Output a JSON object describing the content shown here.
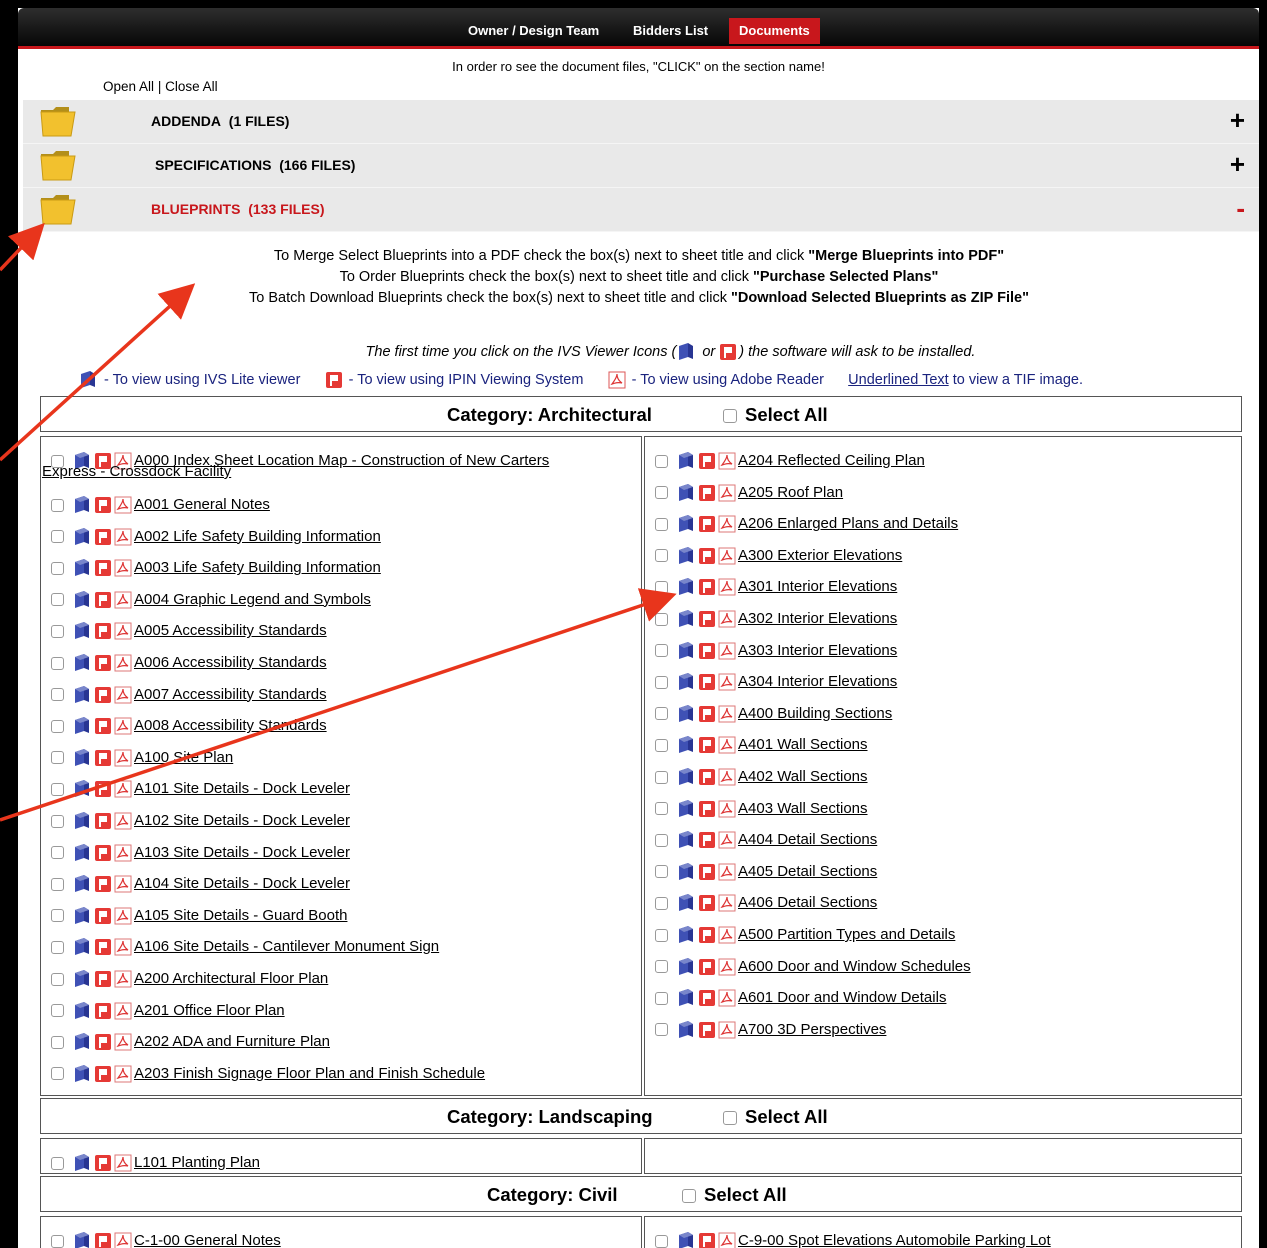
{
  "nav": {
    "tabs": [
      {
        "label": "Owner / Design Team"
      },
      {
        "label": "Bidders List"
      },
      {
        "label": "Documents"
      }
    ]
  },
  "notice": "In order ro see the document files, \"CLICK\" on the section name!",
  "open_all": "Open All",
  "separator": "|",
  "close_all": "Close All",
  "sections": [
    {
      "label": "ADDENDA",
      "count": "(1 FILES)",
      "toggle": "+"
    },
    {
      "label": "SPECIFICATIONS",
      "count": "(166 FILES)",
      "toggle": "+"
    },
    {
      "label": "BLUEPRINTS",
      "count": "(133 FILES)",
      "toggle": "-"
    }
  ],
  "instructions": [
    {
      "text": "To Merge Select Blueprints into a PDF check the box(s) next to sheet title and click ",
      "bold": "\"Merge Blueprints into PDF\""
    },
    {
      "text": "To Order Blueprints check the box(s) next to sheet title and click ",
      "bold": "\"Purchase Selected Plans\""
    },
    {
      "text": "To Batch Download Blueprints check the box(s) next to sheet title and click ",
      "bold": "\"Download Selected Blueprints as ZIP File\""
    }
  ],
  "first_time": {
    "a": "The first time you click on the IVS Viewer Icons (",
    "or": " or ",
    "b": ") the software will ask to be installed."
  },
  "legend": {
    "ivs": "- To view using IVS Lite viewer",
    "ipin": "- To view using IPIN Viewing System",
    "adobe": "- To view using Adobe Reader",
    "tif_link": "Underlined Text",
    "tif_rest": " to view a TIF image."
  },
  "select_all": "Select All",
  "categories": [
    {
      "title": "Category: Architectural",
      "left": [
        "A000 Index Sheet Location Map - Construction of New Carters",
        "Express - Crossdock Facility",
        "A001 General Notes",
        "A002 Life Safety Building Information",
        "A003 Life Safety Building Information",
        "A004 Graphic Legend and Symbols",
        "A005 Accessibility Standards",
        "A006 Accessibility Standards",
        "A007 Accessibility Standards",
        "A008 Accessibility Standards",
        "A100 Site Plan",
        "A101 Site Details - Dock Leveler",
        "A102 Site Details - Dock Leveler",
        "A103 Site Details - Dock Leveler",
        "A104 Site Details - Dock Leveler",
        "A105 Site Details - Guard Booth",
        "A106 Site Details - Cantilever Monument Sign",
        "A200 Architectural Floor Plan",
        "A201 Office Floor Plan",
        "A202 ADA and Furniture Plan",
        "A203 Finish Signage Floor Plan and Finish Schedule"
      ],
      "right": [
        "A204 Reflected Ceiling Plan",
        "A205 Roof Plan",
        "A206 Enlarged Plans and Details",
        "A300 Exterior Elevations",
        "A301 Interior Elevations",
        "A302 Interior Elevations",
        "A303 Interior Elevations",
        "A304 Interior Elevations",
        "A400 Building Sections",
        "A401 Wall Sections",
        "A402 Wall Sections",
        "A403 Wall Sections",
        "A404 Detail Sections",
        "A405 Detail Sections",
        "A406 Detail Sections",
        "A500 Partition Types and Details",
        "A600 Door and Window Schedules",
        "A601 Door and Window Details",
        "A700 3D Perspectives"
      ]
    },
    {
      "title": "Category: Landscaping",
      "left": [
        "L101 Planting Plan"
      ],
      "right": []
    },
    {
      "title": "Category: Civil",
      "left": [
        "C-1-00 General Notes"
      ],
      "right": [
        "C-9-00 Spot Elevations Automobile Parking Lot"
      ]
    }
  ],
  "colors": {
    "accent": "#c8171c",
    "arrow": "#e8351c",
    "section_bg": "#e9e9e9",
    "link": "#1a237e"
  }
}
